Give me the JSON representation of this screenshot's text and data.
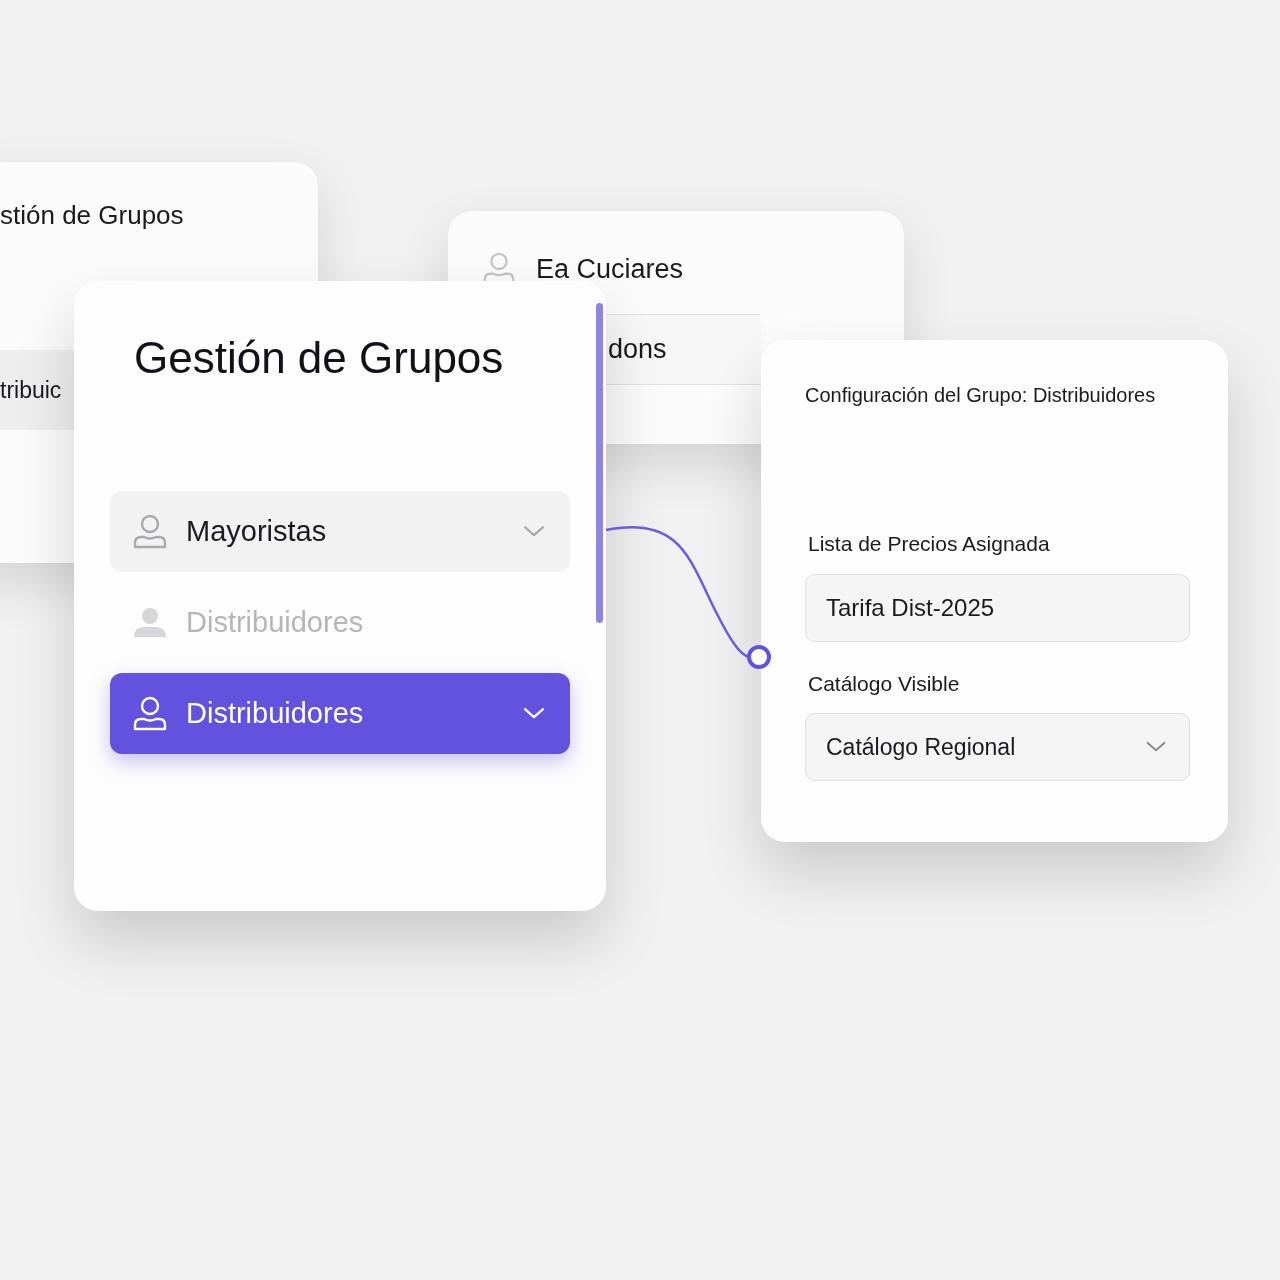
{
  "back_panel_left": {
    "title": "stión de Grupos",
    "row_label": "tribuic"
  },
  "back_panel_middle": {
    "group_label": "Ea Cuciares",
    "field_value": "dons"
  },
  "groups_panel": {
    "title": "Gestión de Grupos",
    "items": [
      {
        "label": "Mayoristas",
        "kind": "dropdown",
        "selected": false,
        "disabled": false
      },
      {
        "label": "Distribuidores",
        "kind": "plain",
        "selected": false,
        "disabled": true
      },
      {
        "label": "Distribuidores",
        "kind": "dropdown",
        "selected": true,
        "disabled": false
      }
    ]
  },
  "config_panel": {
    "title": "Configuración del Grupo: Distribuidores",
    "fields": [
      {
        "label": "Lista de Precios Asignada",
        "kind": "text",
        "value": "Tarifa Dist-2025"
      },
      {
        "label": "Catálogo Visible",
        "kind": "select",
        "value": "Catálogo Regional"
      }
    ]
  }
}
